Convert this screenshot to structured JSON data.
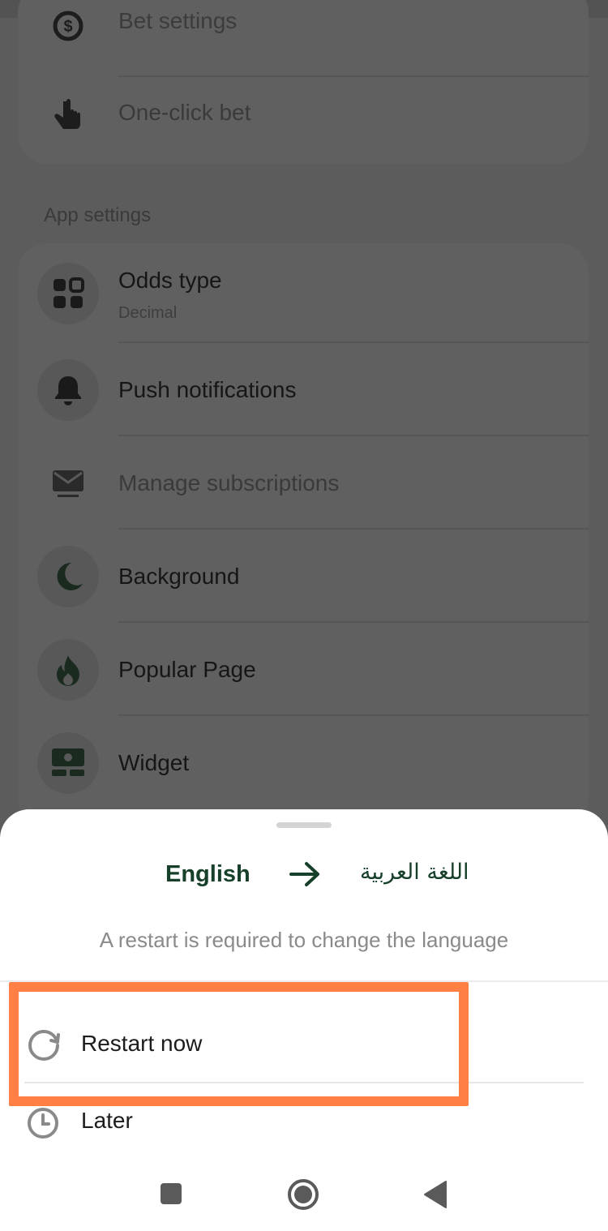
{
  "settings": {
    "top_items": [
      {
        "label": "Bet settings",
        "icon": "dollar-refresh-icon"
      },
      {
        "label": "One-click bet",
        "icon": "tap-finger-icon"
      }
    ],
    "app_section_title": "App settings",
    "app_items": [
      {
        "label": "Odds type",
        "sub": "Decimal",
        "icon": "grid-icon"
      },
      {
        "label": "Push notifications",
        "icon": "bell-icon"
      },
      {
        "label": "Manage subscriptions",
        "icon": "mail-icon"
      },
      {
        "label": "Background",
        "icon": "moon-icon"
      },
      {
        "label": "Popular Page",
        "icon": "flame-icon"
      },
      {
        "label": "Widget",
        "icon": "widget-icon"
      }
    ]
  },
  "sheet": {
    "from_language": "English",
    "to_language": "اللغة العربية",
    "notice": "A restart is required to change the language",
    "options": [
      {
        "label": "Restart now",
        "icon": "restart-icon"
      },
      {
        "label": "Later",
        "icon": "clock-icon"
      }
    ]
  },
  "colors": {
    "accent": "#17402a",
    "highlight": "#ff7f44",
    "overlay": "#5c5c5c"
  },
  "navbar": {
    "buttons": [
      "recents-square-icon",
      "home-circle-icon",
      "back-triangle-icon"
    ]
  }
}
